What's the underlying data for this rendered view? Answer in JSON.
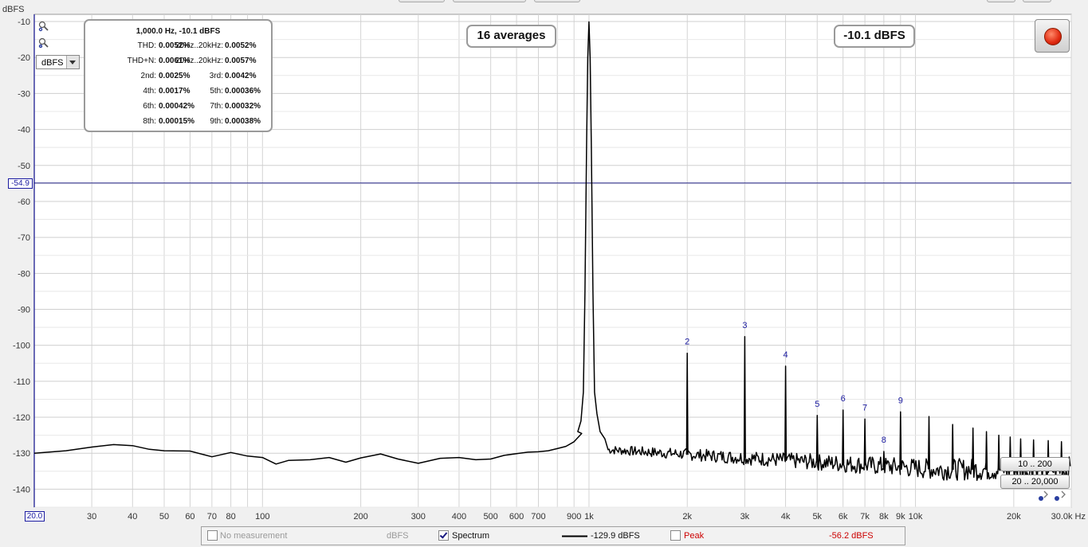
{
  "unit_select": {
    "value": "dBFS"
  },
  "info": {
    "title": "1,000.0 Hz, -10.1 dBFS",
    "rows": [
      {
        "l1": "THD:",
        "v1": "0.0052%",
        "l2": "20Hz..20kHz:",
        "v2": "0.0052%"
      },
      {
        "l1": "THD+N:",
        "v1": "0.0061%",
        "l2": "20Hz..20kHz:",
        "v2": "0.0057%"
      },
      {
        "l1": "2nd:",
        "v1": "0.0025%",
        "l2": "3rd:",
        "v2": "0.0042%"
      },
      {
        "l1": "4th:",
        "v1": "0.0017%",
        "l2": "5th:",
        "v2": "0.00036%"
      },
      {
        "l1": "6th:",
        "v1": "0.00042%",
        "l2": "7th:",
        "v2": "0.00032%"
      },
      {
        "l1": "8th:",
        "v1": "0.00015%",
        "l2": "9th:",
        "v2": "0.00038%"
      }
    ]
  },
  "averages_label": "16 averages",
  "level_label": "-10.1 dBFS",
  "cursor_value_label": "-54.9",
  "x_start_label": "20.0",
  "range_buttons": {
    "y_range": "10 .. 200",
    "x_range": "20 .. 20,000"
  },
  "legend": {
    "no_measurement": "No measurement",
    "unit": "dBFS",
    "spectrum": "Spectrum",
    "spectrum_value": "-129.9 dBFS",
    "peak": "Peak",
    "peak_value": "-56.2 dBFS"
  },
  "colors": {
    "trace": "#000000",
    "cursor_line": "#1a1a80",
    "harmonic_label": "#1a1aa0",
    "peak_text": "#cc0000",
    "grid": "#d4d4d4"
  },
  "chart_data": {
    "type": "line",
    "xscale": "log",
    "xlim": [
      20,
      30000
    ],
    "ylim": [
      -145,
      -8
    ],
    "ylabel": "dBFS",
    "xlabel": "",
    "grid": true,
    "y_ticks": [
      -10,
      -20,
      -30,
      -40,
      -50,
      -60,
      -70,
      -80,
      -90,
      -100,
      -110,
      -120,
      -130,
      -140
    ],
    "x_ticks": [
      {
        "f": 30,
        "label": "30"
      },
      {
        "f": 40,
        "label": "40"
      },
      {
        "f": 50,
        "label": "50"
      },
      {
        "f": 60,
        "label": "60"
      },
      {
        "f": 70,
        "label": "70"
      },
      {
        "f": 80,
        "label": "80"
      },
      {
        "f": 100,
        "label": "100"
      },
      {
        "f": 200,
        "label": "200"
      },
      {
        "f": 300,
        "label": "300"
      },
      {
        "f": 400,
        "label": "400"
      },
      {
        "f": 500,
        "label": "500"
      },
      {
        "f": 600,
        "label": "600"
      },
      {
        "f": 700,
        "label": "700"
      },
      {
        "f": 900,
        "label": "900"
      },
      {
        "f": 1000,
        "label": "1k"
      },
      {
        "f": 2000,
        "label": "2k"
      },
      {
        "f": 3000,
        "label": "3k"
      },
      {
        "f": 4000,
        "label": "4k"
      },
      {
        "f": 5000,
        "label": "5k"
      },
      {
        "f": 6000,
        "label": "6k"
      },
      {
        "f": 7000,
        "label": "7k"
      },
      {
        "f": 8000,
        "label": "8k"
      },
      {
        "f": 9000,
        "label": "9k"
      },
      {
        "f": 10000,
        "label": "10k"
      },
      {
        "f": 20000,
        "label": "20k"
      },
      {
        "f": 30000,
        "label": "30.0k Hz"
      }
    ],
    "cursor_level": -54.9,
    "noise_floor_points": [
      [
        20,
        -130
      ],
      [
        25,
        -129.3
      ],
      [
        30,
        -128.3
      ],
      [
        35,
        -127.6
      ],
      [
        40,
        -127.9
      ],
      [
        45,
        -128.9
      ],
      [
        50,
        -129.3
      ],
      [
        60,
        -129.4
      ],
      [
        70,
        -131
      ],
      [
        80,
        -129.8
      ],
      [
        90,
        -130.8
      ],
      [
        100,
        -131.2
      ],
      [
        110,
        -133
      ],
      [
        120,
        -132
      ],
      [
        140,
        -131.8
      ],
      [
        160,
        -131.2
      ],
      [
        180,
        -132.5
      ],
      [
        200,
        -131.3
      ],
      [
        230,
        -130.2
      ],
      [
        260,
        -131.6
      ],
      [
        300,
        -132.8
      ],
      [
        350,
        -131.4
      ],
      [
        400,
        -131.2
      ],
      [
        450,
        -131.8
      ],
      [
        500,
        -131.6
      ],
      [
        550,
        -130.6
      ],
      [
        600,
        -130.1
      ],
      [
        650,
        -129.7
      ],
      [
        700,
        -129.6
      ],
      [
        750,
        -129.3
      ],
      [
        800,
        -128.7
      ],
      [
        850,
        -128.1
      ],
      [
        900,
        -126.8
      ],
      [
        950,
        -124.5
      ]
    ],
    "fundamental": {
      "f": 1000,
      "level": -10.1
    },
    "harmonics": [
      {
        "n": "2",
        "f": 2000,
        "level": -102.2
      },
      {
        "n": "3",
        "f": 3000,
        "level": -97.6
      },
      {
        "n": "4",
        "f": 4000,
        "level": -105.8
      },
      {
        "n": "5",
        "f": 5000,
        "level": -119.5
      },
      {
        "n": "6",
        "f": 6000,
        "level": -118
      },
      {
        "n": "7",
        "f": 7000,
        "level": -120.5
      },
      {
        "n": "8",
        "f": 8000,
        "level": -129.5
      },
      {
        "n": "9",
        "f": 9000,
        "level": -118.5
      }
    ],
    "higher_harmonics": [
      {
        "f": 11000,
        "level": -119.8
      },
      {
        "f": 13000,
        "level": -122
      },
      {
        "f": 15000,
        "level": -123
      },
      {
        "f": 16500,
        "level": -124
      },
      {
        "f": 18000,
        "level": -125
      },
      {
        "f": 19500,
        "level": -125.5
      },
      {
        "f": 21000,
        "level": -126
      },
      {
        "f": 23000,
        "level": -126.3
      },
      {
        "f": 25500,
        "level": -126.5
      },
      {
        "f": 28000,
        "level": -126.8
      }
    ],
    "noise_band": {
      "f_start": 1100,
      "f_end": 30000,
      "level_start": -129,
      "level_end": -134.5
    }
  }
}
